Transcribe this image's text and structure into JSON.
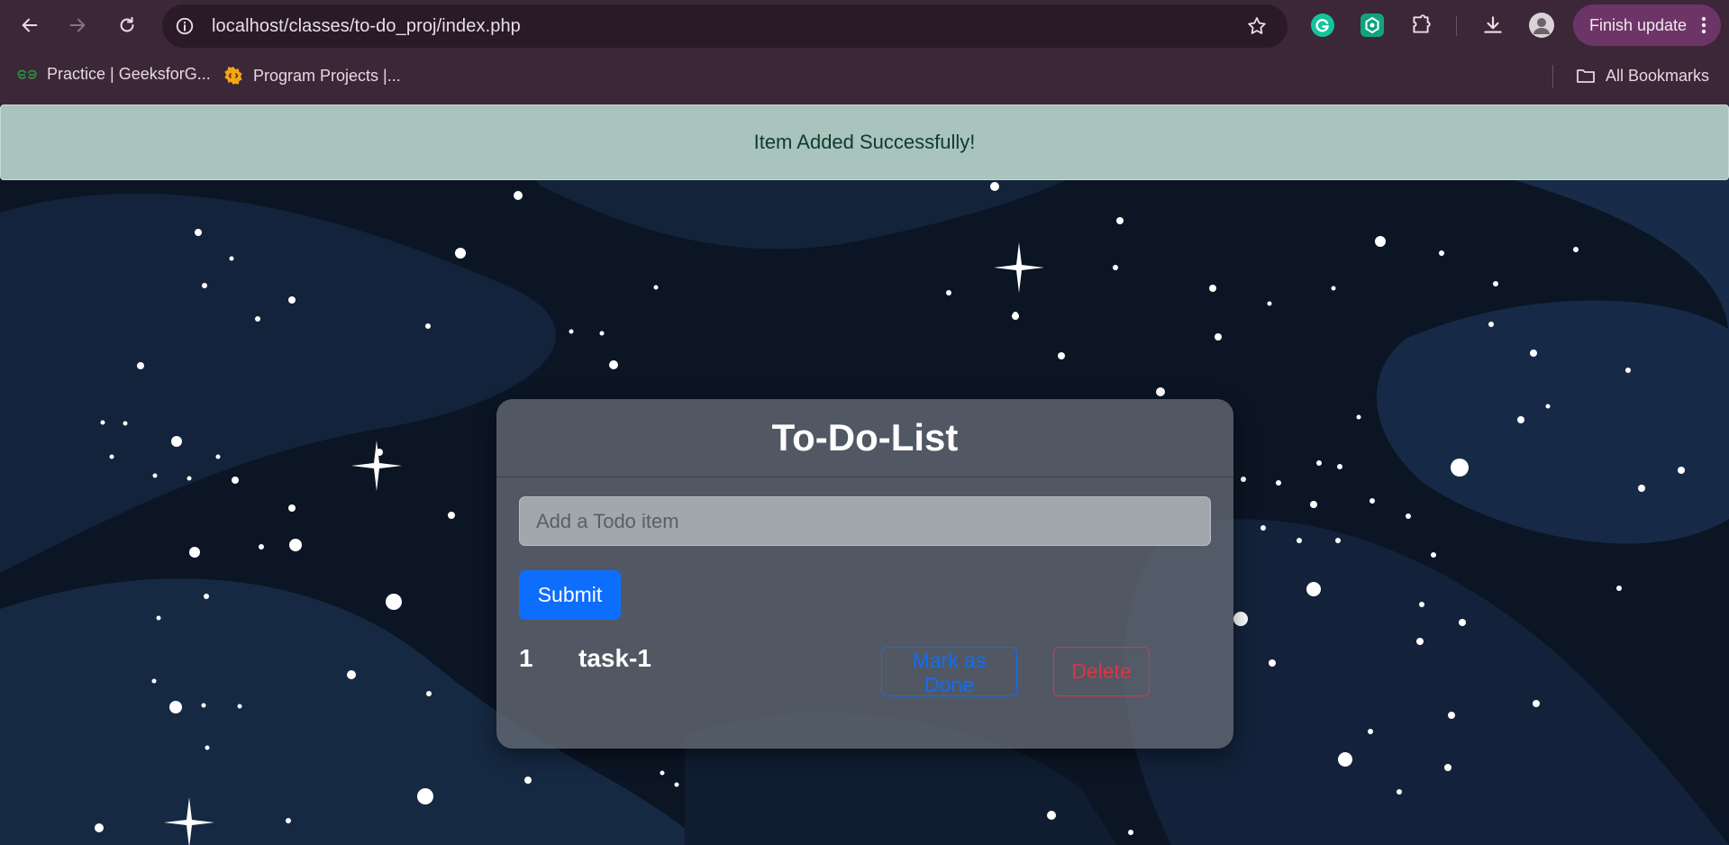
{
  "browser": {
    "url": "localhost/classes/to-do_proj/index.php",
    "finish_update_label": "Finish update",
    "bookmarks": [
      {
        "label": "Practice | GeeksforG...",
        "icon": "geeksforgeeks-icon"
      },
      {
        "label": "Program Projects |...",
        "icon": "program-projects-icon"
      }
    ],
    "all_bookmarks_label": "All Bookmarks"
  },
  "alert": {
    "message": "Item Added Successfully!"
  },
  "todo": {
    "title": "To-Do-List",
    "input_placeholder": "Add a Todo item",
    "submit_label": "Submit",
    "items": [
      {
        "number": "1",
        "task": "task-1",
        "done_label": "Mark as Done",
        "delete_label": "Delete"
      }
    ]
  },
  "colors": {
    "primary": "#0d6efd",
    "danger": "#dc3545",
    "alert_bg": "#a9c3bd",
    "chrome_bg": "#3b2737"
  }
}
